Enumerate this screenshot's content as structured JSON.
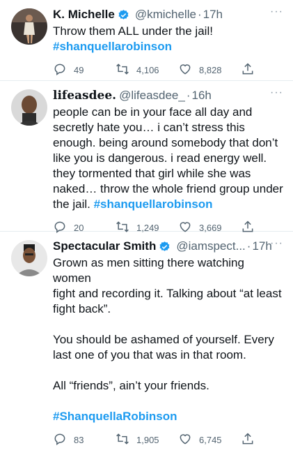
{
  "tweets": [
    {
      "name": "K. Michelle",
      "handle": "@kmichelle",
      "separator": "·",
      "time": "17h",
      "lines": [
        "Throw them ALL under the jail!"
      ],
      "hashtag": "#shanquellarobinson",
      "replies": "49",
      "retweets": "4,106",
      "likes": "8,828",
      "verified": true
    },
    {
      "name": "lifeasdee.",
      "handle": "@lifeasdee_",
      "separator": "·",
      "time": "16h",
      "lines": [
        "people can be in your face all day and",
        "secretly hate you… i can’t stress this",
        "enough. being around somebody that don’t",
        "like you is dangerous. i read energy well.",
        "they tormented that girl while she was",
        "naked… throw the whole friend group under"
      ],
      "last_line_prefix": "the jail. ",
      "hashtag": "#shanquellarobinson",
      "replies": "20",
      "retweets": "1,249",
      "likes": "3,669",
      "verified": false
    },
    {
      "name": "Spectacular Smith",
      "handle": "@iamspect...",
      "separator": "·",
      "time": "17h",
      "para1": [
        "Grown as men sitting there watching women",
        "fight and recording it. Talking about “at least",
        "fight back”."
      ],
      "para2": [
        "You should be ashamed of yourself. Every",
        "last one of you that was in that room."
      ],
      "para3": [
        "All “friends”, ain’t your friends."
      ],
      "hashtag": "#ShanquellaRobinson",
      "replies": "83",
      "retweets": "1,905",
      "likes": "6,745",
      "verified": true
    }
  ],
  "more_glyph": "···",
  "colors": {
    "link": "#1d9bf0",
    "muted": "#536471",
    "verified": "#1d9bf0"
  },
  "icons": [
    "reply-icon",
    "retweet-icon",
    "like-icon",
    "share-icon",
    "verified-badge-icon",
    "more-icon"
  ]
}
